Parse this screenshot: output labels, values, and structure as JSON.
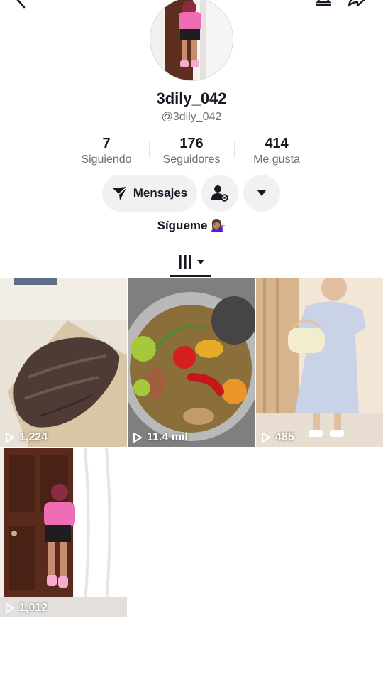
{
  "profile": {
    "username": "3dily_042",
    "handle": "@3dily_042",
    "bio": "Sígueme",
    "bio_emoji": "💁🏽‍♀️"
  },
  "stats": [
    {
      "value": "7",
      "label": "Siguiendo"
    },
    {
      "value": "176",
      "label": "Seguidores"
    },
    {
      "value": "414",
      "label": "Me gusta"
    }
  ],
  "actions": {
    "message_label": "Mensajes"
  },
  "icons": {
    "back": "chevron-left-icon",
    "notifications": "bell-icon",
    "share": "share-icon",
    "message": "send-icon",
    "add_friend": "add-friend-icon",
    "more": "caret-down-icon",
    "videos_tab": "grid-icon"
  },
  "videos": [
    {
      "views": "1,224"
    },
    {
      "views": "11.4 mil"
    },
    {
      "views": "485"
    },
    {
      "views": "1,012"
    }
  ]
}
